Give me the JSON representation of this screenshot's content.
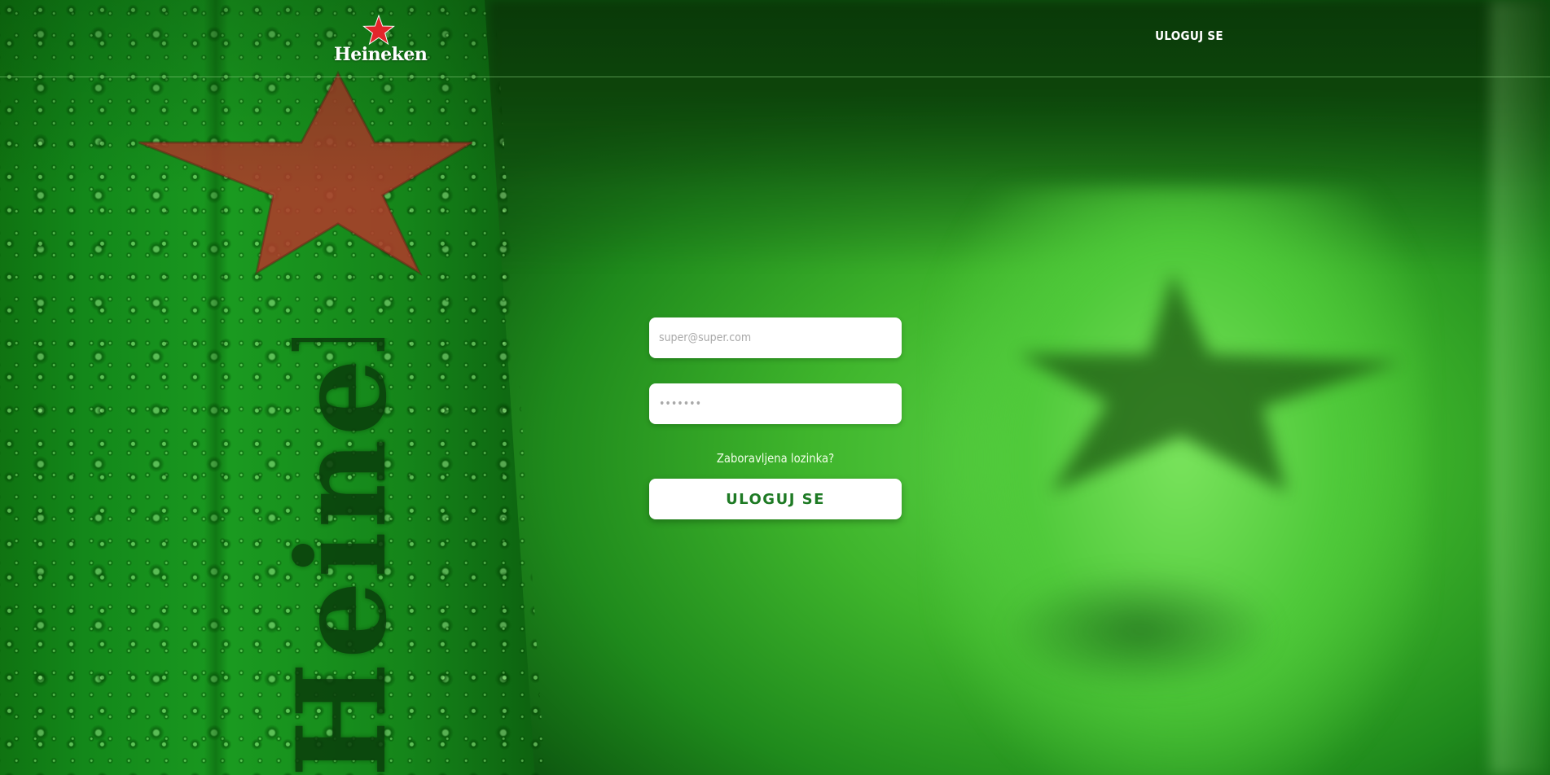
{
  "header": {
    "logo_text": "Heineken",
    "nav_login_label": "ULOGUJ SE"
  },
  "login_form": {
    "email_placeholder": "super@super.com",
    "password_placeholder": "•••••••",
    "forgot_password_label": "Zaboravljena lozinka?",
    "submit_label": "ULOGUJ SE"
  },
  "background": {
    "bottle_label": "Heineken"
  },
  "colors": {
    "brand_green": "#1e7a24",
    "star_red": "#e3242b",
    "background_green": "#3fb52c"
  },
  "icons": {
    "logo": "red-star-icon"
  }
}
